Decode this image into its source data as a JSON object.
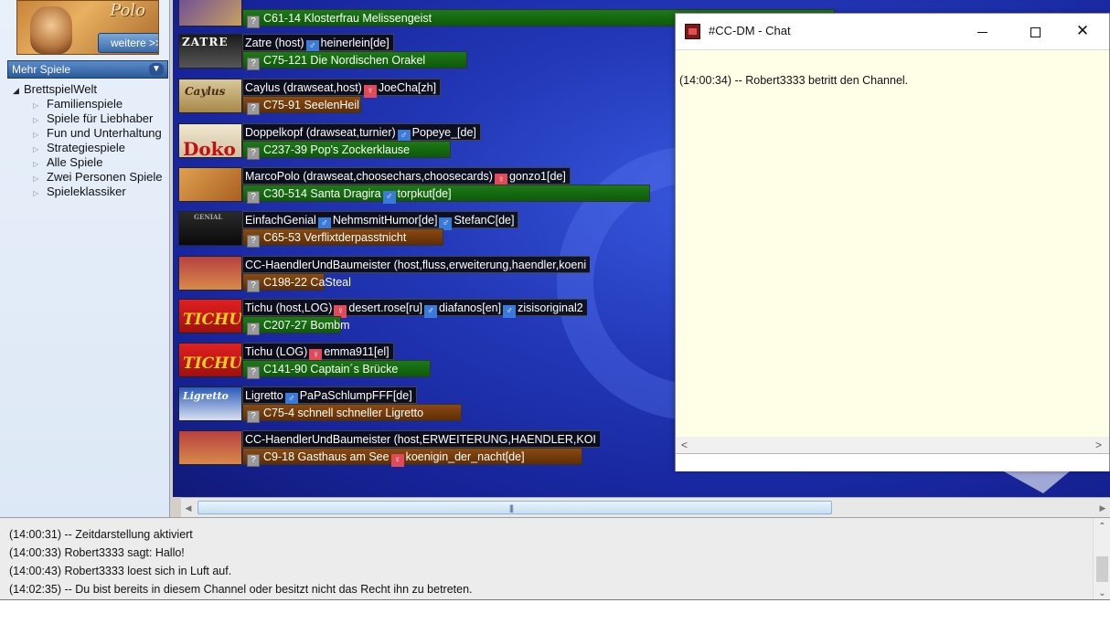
{
  "sidebar": {
    "featured_title": "Polo",
    "weitere_label": "weitere >>",
    "dropdown_label": "Mehr Spiele",
    "tree_root": "BrettspielWelt",
    "tree_items": [
      "Familienspiele",
      "Spiele für Liebhaber",
      "Fun und Unterhaltung",
      "Strategiespiele",
      "Alle Spiele",
      "Zwei Personen Spiele",
      "Spieleklassiker"
    ]
  },
  "rooms": [
    {
      "thumb": "",
      "line1": "",
      "line2": "C61-14 Klosterfrau Melissengeist",
      "color": "green"
    },
    {
      "thumb": "ZATRE",
      "line1": "Zatre (host)",
      "player1": "heinerlein[de]",
      "p1sex": "m",
      "line2": "C75-121 Die Nordischen Orakel",
      "color": "green"
    },
    {
      "thumb": "Caylus",
      "line1": "Caylus (drawseat,host)",
      "player1": "JoeCha[zh]",
      "p1sex": "f",
      "line2": "C75-91 SeelenHeil",
      "color": "brown"
    },
    {
      "thumb": "Doko",
      "line1": "Doppelkopf (drawseat,turnier)",
      "player1": "Popeye_[de]",
      "p1sex": "m",
      "line2": "C237-39 Pop's Zockerklause",
      "color": "green"
    },
    {
      "thumb": "",
      "line1": "MarcoPolo (drawseat,choosechars,choosecards)",
      "player1": "gonzo1[de]",
      "p1sex": "f",
      "line2": "C30-514 Santa Dragira",
      "line2_player": "torpkut[de]",
      "color": "green"
    },
    {
      "thumb": "GENIAL",
      "line1": "EinfachGenial",
      "player1": "NehmsmitHumor[de]",
      "p1sex": "m",
      "player2": "StefanC[de]",
      "p2sex": "m",
      "line2": "C65-53 Verflixtderpasstnicht",
      "color": "brown"
    },
    {
      "thumb": "",
      "line1": "CC-HaendlerUndBaumeister (host,fluss,erweiterung,haendler,koeni",
      "line2": "C198-22 CaSteal",
      "color": "brown"
    },
    {
      "thumb": "TICHU",
      "line1": "Tichu (host,LOG)",
      "player1": "desert.rose[ru]",
      "p1sex": "f",
      "player2": "diafanos[en]",
      "p2sex": "m",
      "player3": "zisisoriginal2",
      "p3sex": "m",
      "line2": "C207-27 Bombm",
      "color": "green"
    },
    {
      "thumb": "TICHU",
      "line1": "Tichu (LOG)",
      "player1": "emma911[el]",
      "p1sex": "f",
      "line2": "C141-90 Captain´s Brücke",
      "color": "green"
    },
    {
      "thumb": "Ligretto",
      "line1": "Ligretto",
      "player1": "PaPaSchlumpFFF[de]",
      "p1sex": "m",
      "line2": "C75-4 schnell schneller Ligretto",
      "color": "brown"
    },
    {
      "thumb": "",
      "line1": "CC-HaendlerUndBaumeister (host,ERWEITERUNG,HAENDLER,KOI",
      "line2": "C9-18 Gasthaus am See",
      "line2_player": "koenigin_der_nacht[de]",
      "color": "brown"
    }
  ],
  "log": {
    "lines": [
      "(14:00:31) -- Zeitdarstellung aktiviert",
      "(14:00:33) Robert3333 sagt: Hallo!",
      "(14:00:43) Robert3333 loest sich in Luft auf.",
      "(14:02:35) -- Du bist bereits in diesem Channel oder besitzt nicht das Recht ihn zu betreten."
    ]
  },
  "chat": {
    "title": "#CC-DM - Chat",
    "message": "(14:00:34) -- Robert3333 betritt den Channel."
  },
  "icons": {
    "male": "male-icon",
    "female": "female-icon",
    "unknown": "question-icon"
  },
  "colors": {
    "green_row": "#1c7a16",
    "brown_row": "#8a4a10",
    "chat_bg": "#fffee6",
    "room_bg": "#2238b8"
  }
}
